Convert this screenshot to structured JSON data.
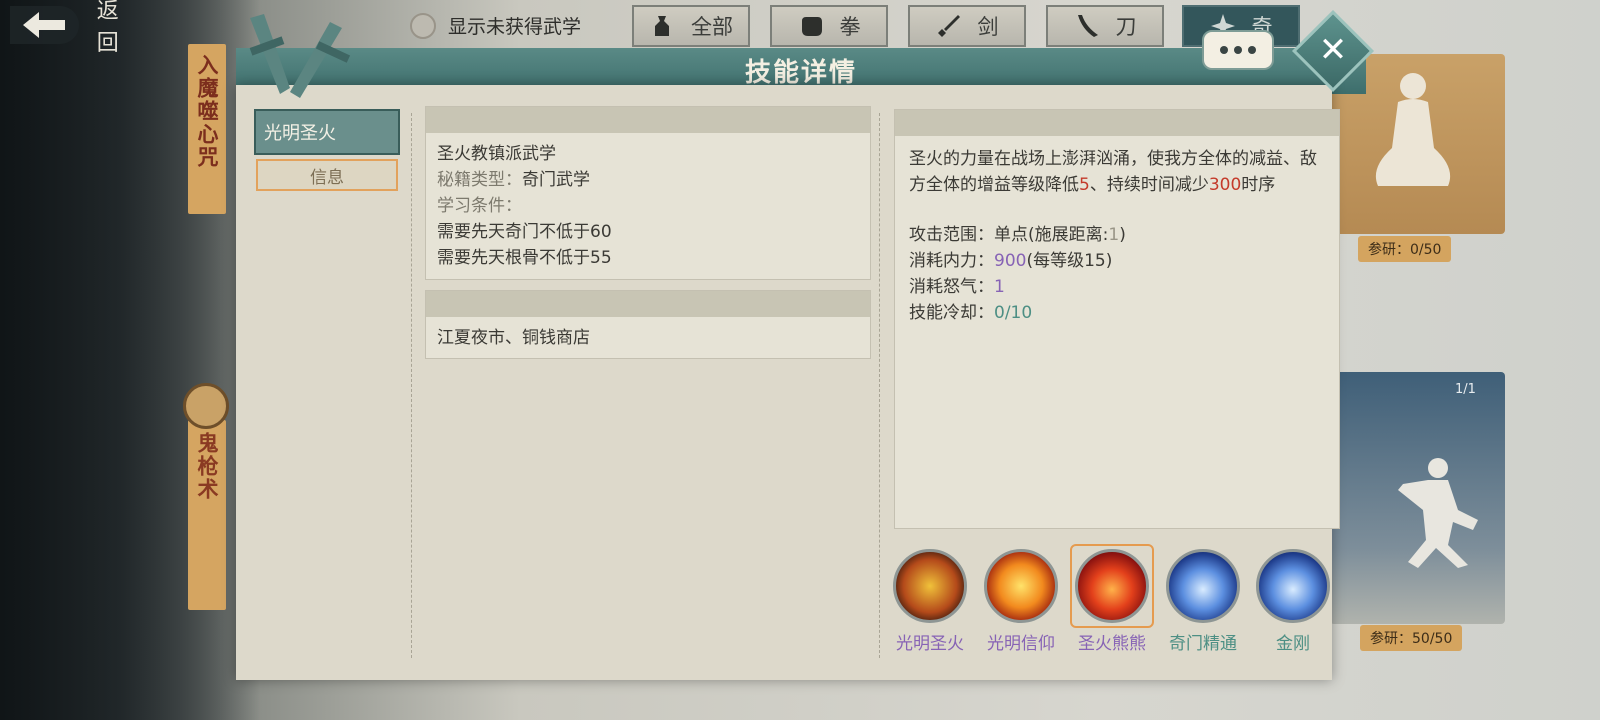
{
  "topbar": {
    "back_label": "返回",
    "show_unobtained_label": "显示未获得武学",
    "categories": [
      {
        "label": "全部",
        "icon": "bag-icon"
      },
      {
        "label": "拳",
        "icon": "fist-icon"
      },
      {
        "label": "剑",
        "icon": "sword-icon"
      },
      {
        "label": "刀",
        "icon": "blade-icon"
      },
      {
        "label": "奇",
        "icon": "shuriken-icon"
      }
    ]
  },
  "background": {
    "left_card_1": "入魔噬心咒",
    "left_card_2": "鬼枪术",
    "right_research_1": "参研：0/50",
    "right_research_2": "参研：50/50",
    "right_count": "1/1"
  },
  "dialog": {
    "title": "技能详情",
    "skill_tab": "光明圣火",
    "info_tab": "信息",
    "basic": {
      "school": "圣火教镇派武学",
      "type_label": "秘籍类型：",
      "type_value": "奇门武学",
      "req_label": "学习条件：",
      "req_1": "需要先天奇门不低于60",
      "req_2": "需要先天根骨不低于55"
    },
    "source": "江夏夜市、铜钱商店",
    "description": {
      "part1": "圣火的力量在战场上澎湃汹涌，使我方全体的减益、敌方全体的增益等级降低",
      "num1": "5",
      "part2": "、持续时间减少",
      "num2": "300",
      "part3": "时序"
    },
    "stats": {
      "range_label": "攻击范围：",
      "range_value": "单点(施展距离:",
      "range_dist": "1",
      "range_close": ")",
      "mp_label": "消耗内力：",
      "mp_value": "900",
      "mp_extra": "(每等级15)",
      "rage_label": "消耗怒气：",
      "rage_value": "1",
      "cd_label": "技能冷却：",
      "cd_value": "0/10"
    },
    "skills": [
      {
        "name": "光明圣火",
        "color": "#8763b5"
      },
      {
        "name": "光明信仰",
        "color": "#8763b5"
      },
      {
        "name": "圣火熊熊",
        "color": "#8763b5"
      },
      {
        "name": "奇门精通",
        "color": "#4d8f84"
      },
      {
        "name": "金刚",
        "color": "#4d8f84"
      }
    ]
  }
}
